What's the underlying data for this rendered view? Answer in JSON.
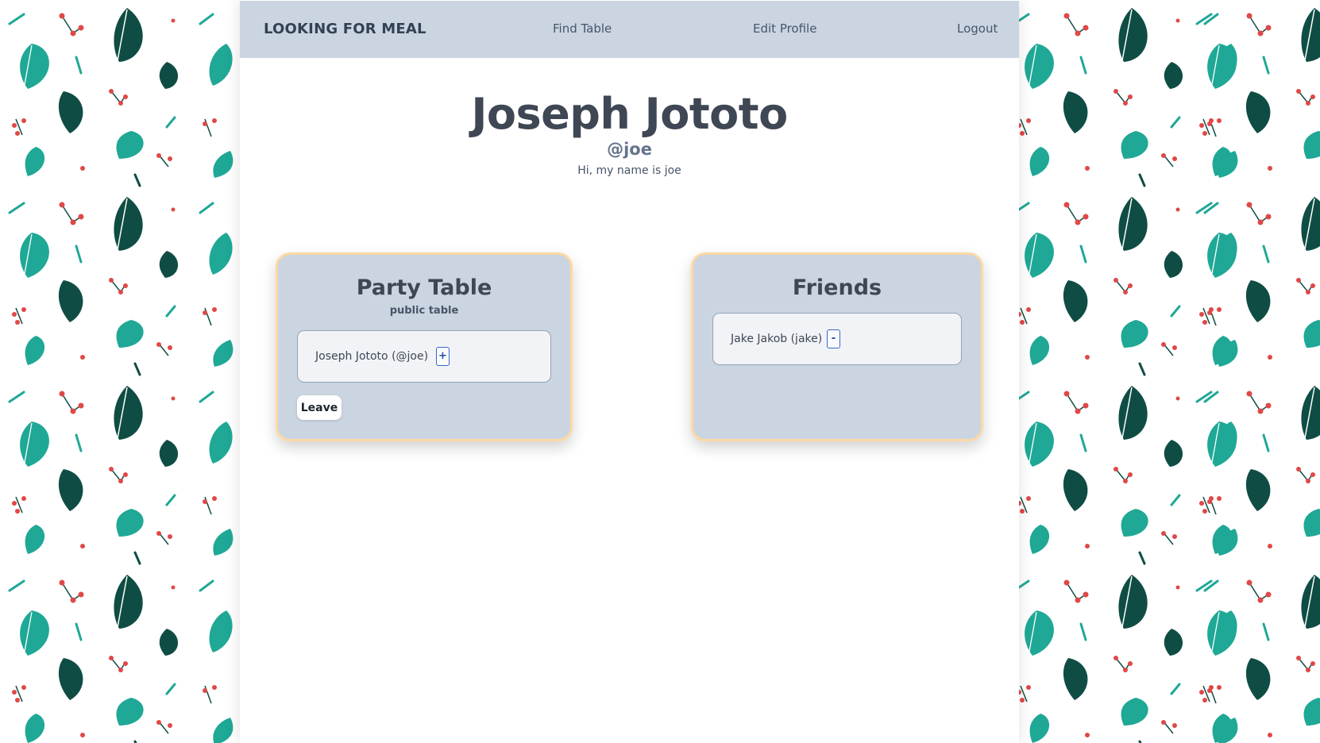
{
  "nav": {
    "brand": "LOOKING FOR MEAL",
    "find_table": "Find Table",
    "edit_profile": "Edit Profile",
    "logout": "Logout"
  },
  "profile": {
    "name": "Joseph Jototo",
    "handle": "@joe",
    "bio": "Hi, my name is joe"
  },
  "table_card": {
    "title": "Party Table",
    "subtitle": "public table",
    "members": [
      {
        "label": "Joseph Jototo (@joe)",
        "action": "+"
      }
    ],
    "leave_label": "Leave"
  },
  "friends_card": {
    "title": "Friends",
    "friends": [
      {
        "label": "Jake Jakob (jake)",
        "action": "-"
      }
    ]
  },
  "colors": {
    "nav_bg": "#cbd5e1",
    "card_bg": "#cbd5e1",
    "card_border": "#fcd9a4",
    "leaf_dark": "#0f4d44",
    "leaf_teal": "#1fa896",
    "berry": "#e04848"
  }
}
